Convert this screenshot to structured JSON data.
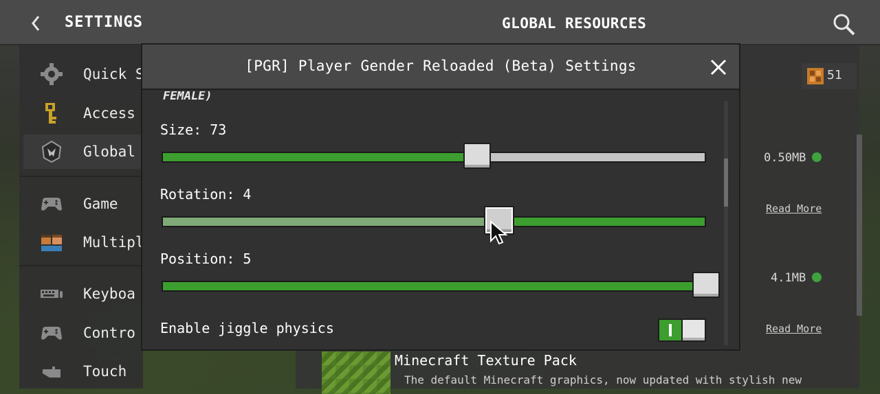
{
  "header": {
    "title": "SETTINGS",
    "section": "GLOBAL RESOURCES"
  },
  "sidebar": {
    "items": [
      {
        "label": "Quick S",
        "icon": "gear-icon"
      },
      {
        "label": "Access",
        "icon": "key-icon"
      },
      {
        "label": "Global",
        "icon": "global-resources-icon"
      },
      {
        "label": "Game",
        "icon": "controller-icon"
      },
      {
        "label": "Multipla",
        "icon": "players-icon"
      },
      {
        "label": "Keyboa",
        "icon": "keyboard-icon"
      },
      {
        "label": "Contro",
        "icon": "controller-icon"
      },
      {
        "label": "Touch",
        "icon": "touch-hand-icon"
      }
    ]
  },
  "resources": {
    "badge_count": "51",
    "items": [
      {
        "size": "0.50MB",
        "link": "Read More"
      },
      {
        "size": "4.1MB",
        "link": "Read More"
      }
    ],
    "pack_title": "Minecraft Texture Pack",
    "pack_description": "The default Minecraft graphics, now updated with stylish new"
  },
  "modal": {
    "title": "[PGR] Player Gender Reloaded (Beta) Settings",
    "clipped_heading": "FEMALE)",
    "sliders": [
      {
        "label": "Size: 73",
        "value_fraction": 0.58
      },
      {
        "label": "Rotation: 4",
        "value_fraction": 0.62
      },
      {
        "label": "Position: 5",
        "value_fraction": 1.0
      }
    ],
    "toggle": {
      "label": "Enable jiggle physics",
      "state": "on"
    }
  },
  "colors": {
    "accent_green": "#3c9e2f",
    "status_dot": "#3fa33d"
  }
}
